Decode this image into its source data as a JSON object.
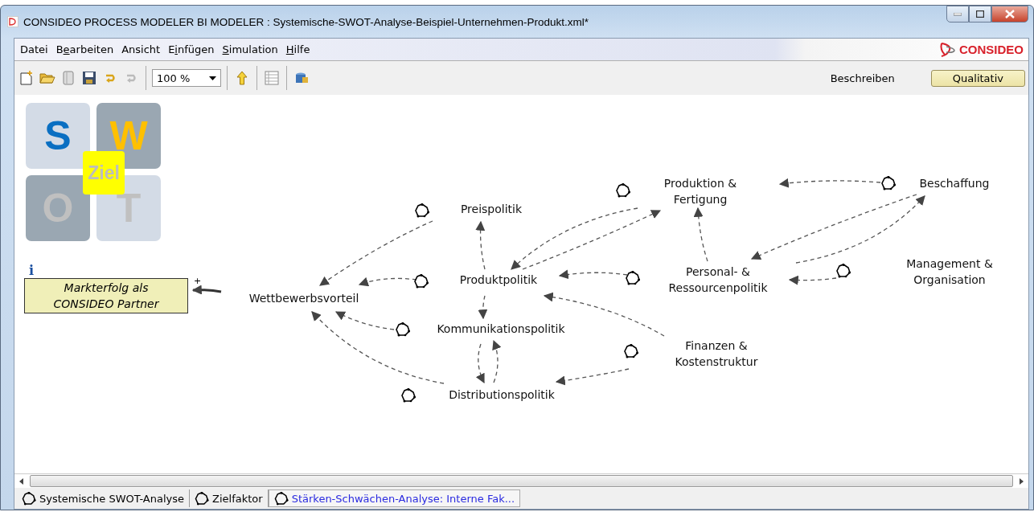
{
  "window": {
    "title": "CONSIDEO PROCESS MODELER BI MODELER : Systemische-SWOT-Analyse-Beispiel-Unternehmen-Produkt.xml*"
  },
  "menu": [
    {
      "after": "Datei"
    },
    {
      "before": "B",
      "key": "e",
      "after": "arbeiten"
    },
    {
      "after": "Ansicht"
    },
    {
      "before": "E",
      "key": "i",
      "after": "nfügen"
    },
    {
      "key": "S",
      "after": "imulation"
    },
    {
      "key": "H",
      "after": "ilfe"
    }
  ],
  "brand": "CONSIDEO",
  "toolbar": {
    "zoom": "100 %",
    "modes": [
      {
        "label": "Beschreiben",
        "selected": false
      },
      {
        "label": "Qualitativ",
        "selected": true
      }
    ]
  },
  "swot_logo": {
    "tiles": [
      "S",
      "W",
      "O",
      "T"
    ],
    "center": "Ziel"
  },
  "goal": {
    "info": "i",
    "label": "Markterfolg als CONSIDEO Partner",
    "polarity": "+"
  },
  "nodes": [
    {
      "label": "Wettbewerbsvorteil"
    },
    {
      "label": "Preispolitik"
    },
    {
      "label": "Produktpolitik"
    },
    {
      "label": "Kommunikationspolitik"
    },
    {
      "label": "Distributionspolitik"
    },
    {
      "label": "Produktion & Fertigung"
    },
    {
      "label": "Beschaffung"
    },
    {
      "label": "Personal- & Ressourcenpolitik"
    },
    {
      "label": "Management & Organisation"
    },
    {
      "label": "Finanzen & Kostenstruktur"
    }
  ],
  "tabs": [
    {
      "label": "Systemische SWOT-Analyse",
      "selected": false
    },
    {
      "label": "Zielfaktor",
      "selected": false
    },
    {
      "label": "Stärken-Schwächen-Analyse: Interne Fak...",
      "selected": true
    }
  ]
}
